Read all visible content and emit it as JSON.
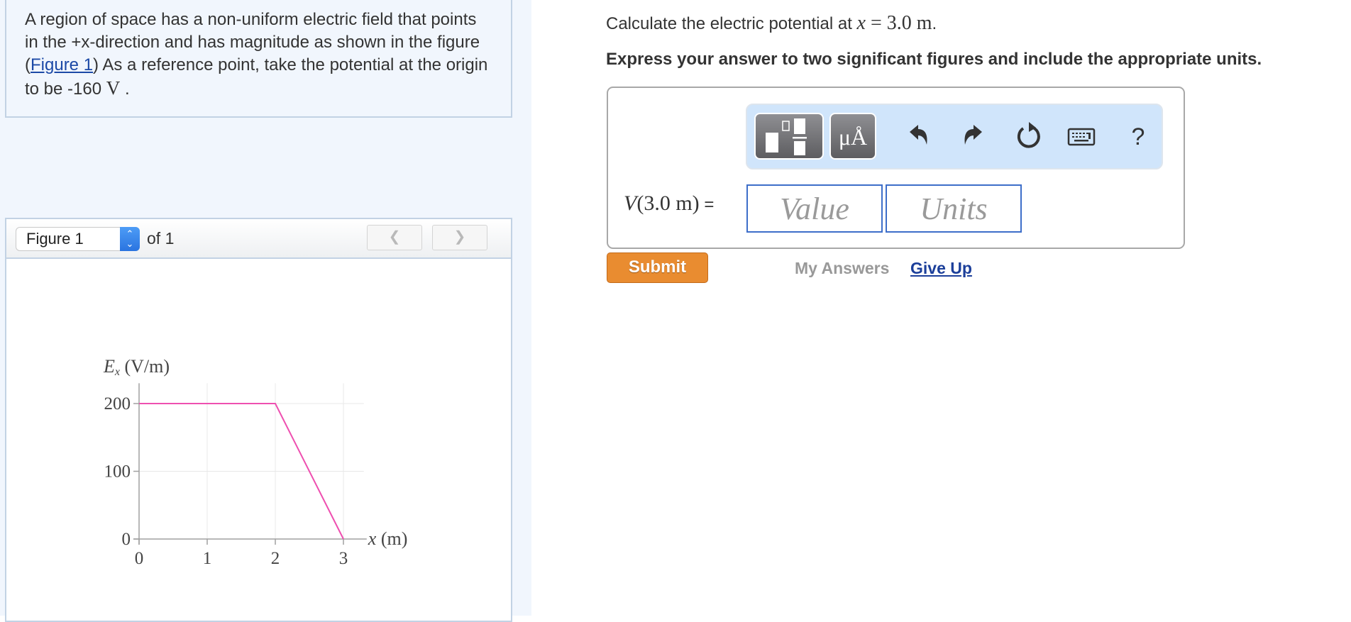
{
  "problem": {
    "intro_before_link": "A region of space has a non-uniform electric field that points in the +x-direction and has magnitude as shown in the figure (",
    "figure_link": "Figure 1",
    "intro_after_link": ") As a reference point, take the potential at the origin to be -160",
    "intro_unit": "V",
    "intro_end": "."
  },
  "figure_panel": {
    "selected_figure": "Figure 1",
    "of_label": "of 1",
    "prev_icon": "chevron-left-icon",
    "next_icon": "chevron-right-icon"
  },
  "chart_data": {
    "type": "line",
    "title": "",
    "xlabel": "x (m)",
    "ylabel_var": "E",
    "ylabel_sub": "x",
    "ylabel_unit": "(V/m)",
    "x_ticks": [
      "0",
      "1",
      "2",
      "3"
    ],
    "y_ticks": [
      "0",
      "100",
      "200"
    ],
    "xlim": [
      0,
      3.3
    ],
    "ylim": [
      0,
      230
    ],
    "grid": true,
    "series": [
      {
        "name": "Ex",
        "color": "#ee4fb0",
        "x": [
          0,
          2,
          3
        ],
        "y": [
          200,
          200,
          0
        ]
      }
    ]
  },
  "question": {
    "prefix": "Calculate the electric potential at ",
    "var": "x",
    "equals": " = 3.0 m",
    "suffix": ".",
    "instruction": "Express your answer to two significant figures and include the appropriate units."
  },
  "toolbar": {
    "buttons": [
      {
        "name": "templates-icon"
      },
      {
        "name": "units-icon",
        "label": "μÅ"
      },
      {
        "name": "undo-icon",
        "glyph": "↶"
      },
      {
        "name": "redo-icon",
        "glyph": "↷"
      },
      {
        "name": "reset-icon",
        "glyph": "↻"
      },
      {
        "name": "keyboard-icon"
      },
      {
        "name": "help-icon",
        "glyph": "?"
      }
    ]
  },
  "answer": {
    "label_var": "V",
    "label_arg": "(3.0 m)",
    "label_eq": " =",
    "value_placeholder": "Value",
    "units_placeholder": "Units",
    "value": "",
    "units": ""
  },
  "actions": {
    "submit_label": "Submit",
    "my_answers_label": "My Answers",
    "give_up_label": "Give Up"
  },
  "colors": {
    "accent_orange": "#e98c30",
    "link_blue": "#1c49a6",
    "panel_bg": "#f1f6fd",
    "toolbar_bg": "#d0e5fb",
    "input_border": "#3d6ec9",
    "curve": "#ee4fb0"
  }
}
